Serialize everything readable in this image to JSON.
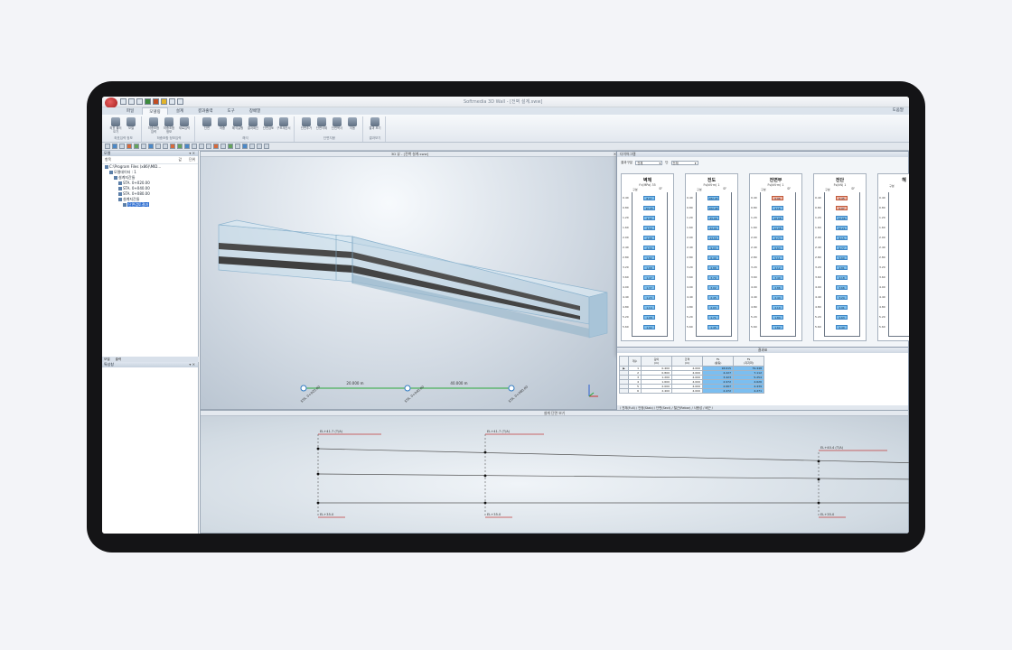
{
  "window": {
    "title": "Softmedia 3D Wall - [전벽 설계.sww]"
  },
  "ribbon": {
    "tabs": [
      {
        "label": "파일"
      },
      {
        "label": "모델링"
      },
      {
        "label": "설계"
      },
      {
        "label": "결과출력"
      },
      {
        "label": "도구"
      },
      {
        "label": "창배열"
      }
    ],
    "help_label": "도움말",
    "groups": [
      {
        "label": "좌표입력 정보",
        "buttons": [
          "좌표 불러오기",
          "모델"
        ]
      },
      {
        "label": "하중조합 정보입력",
        "buttons": [
          "하중조합 입력",
          "하중조합 정보",
          "재료입력"
        ]
      },
      {
        "label": "해석",
        "buttons": [
          "단면",
          "하중",
          "해석실행",
          "결과확인",
          "단면검토",
          "구조계산서"
        ]
      },
      {
        "label": "단면지붕",
        "buttons": [
          "단면추가",
          "단면삭제",
          "단면복사",
          "이동"
        ]
      },
      {
        "label": "결과보기",
        "buttons": [
          "결과 보기"
        ]
      }
    ]
  },
  "tree": {
    "panel_title": "모델",
    "columns": {
      "name": "항목",
      "value": "값",
      "unit": "단위"
    },
    "items": [
      {
        "label": "C:\\Program Files (x86)\\MID...",
        "indent": 0
      },
      {
        "label": "모델데이터 : 1",
        "indent": 1
      },
      {
        "label": "설계지간들",
        "indent": 2
      },
      {
        "label": "STA. 0+020.00",
        "indent": 3
      },
      {
        "label": "STA. 0+040.00",
        "indent": 3
      },
      {
        "label": "STA. 0+080.00",
        "indent": 3
      },
      {
        "label": "설계지간들",
        "indent": 3
      },
      {
        "label": "단면검토결과",
        "indent": 4,
        "selected": true
      }
    ],
    "bottom_tabs": [
      "모델",
      "출력"
    ],
    "lower_panel_title": "특성창"
  },
  "viewport": {
    "title": "3D 뷰 - [전벽 설계.sww]",
    "dims": [
      "20.000 m",
      "40.000 m"
    ],
    "stations": [
      "STA. 0+020.00",
      "STA. 0+040.00",
      "STA. 0+080.00"
    ]
  },
  "diagram": {
    "title": "다이어그램",
    "filter": {
      "label1": "결과구분",
      "value1": "전체",
      "label2": "단",
      "value2": "전체"
    },
    "columns": [
      {
        "title": "벽체",
        "sub": "f'c(MPa) 35",
        "h1": "구분",
        "h2": "SF",
        "rows": [
          {
            "l": "0.40",
            "v": "8.07",
            "red": false
          },
          {
            "l": "0.80",
            "v": "10.05",
            "red": false
          },
          {
            "l": "1.20",
            "v": "4.42",
            "red": false
          },
          {
            "l": "1.60",
            "v": "3.54",
            "red": false
          },
          {
            "l": "2.00",
            "v": "2.98",
            "red": false
          },
          {
            "l": "2.40",
            "v": "2.34",
            "red": false
          },
          {
            "l": "2.80",
            "v": "1.82",
            "red": false
          },
          {
            "l": "3.20",
            "v": "1.68",
            "red": false
          },
          {
            "l": "3.60",
            "v": "1.47",
            "red": false
          },
          {
            "l": "4.00",
            "v": "1.37",
            "red": false
          },
          {
            "l": "4.40",
            "v": "1.23",
            "red": false
          },
          {
            "l": "4.80",
            "v": "1.14",
            "red": false
          },
          {
            "l": "5.20",
            "v": "1.08",
            "red": false
          },
          {
            "l": "5.60",
            "v": "1.02",
            "red": false
          }
        ]
      },
      {
        "title": "전도",
        "sub": "Fs(kN·m) 1",
        "h1": "구분",
        "h2": "SF",
        "rows": [
          {
            "l": "0.40",
            "v": "182.45",
            "red": false
          },
          {
            "l": "0.80",
            "v": "102.48",
            "red": false
          },
          {
            "l": "1.20",
            "v": "45.06",
            "red": false
          },
          {
            "l": "1.60",
            "v": "22.91",
            "red": false
          },
          {
            "l": "2.00",
            "v": "13.55",
            "red": false
          },
          {
            "l": "2.40",
            "v": "9.03",
            "red": false
          },
          {
            "l": "2.80",
            "v": "6.49",
            "red": false
          },
          {
            "l": "3.20",
            "v": "4.88",
            "red": false
          },
          {
            "l": "3.60",
            "v": "3.79",
            "red": false
          },
          {
            "l": "4.00",
            "v": "3.02",
            "red": false
          },
          {
            "l": "4.40",
            "v": "2.45",
            "red": false
          },
          {
            "l": "4.80",
            "v": "2.03",
            "red": false
          },
          {
            "l": "5.20",
            "v": "1.71",
            "red": false
          },
          {
            "l": "5.60",
            "v": "1.45",
            "red": false
          }
        ]
      },
      {
        "title": "전면부",
        "sub": "Fs(kN·m) 1",
        "h1": "구분",
        "h2": "SF",
        "rows": [
          {
            "l": "0.40",
            "v": "0.96",
            "red": true
          },
          {
            "l": "0.80",
            "v": "4.16",
            "red": false
          },
          {
            "l": "1.20",
            "v": "18.08",
            "red": false
          },
          {
            "l": "1.60",
            "v": "12.08",
            "red": false
          },
          {
            "l": "2.00",
            "v": "8.73",
            "red": false
          },
          {
            "l": "2.40",
            "v": "6.63",
            "red": false
          },
          {
            "l": "2.80",
            "v": "5.11",
            "red": false
          },
          {
            "l": "3.20",
            "v": "4.12",
            "red": false
          },
          {
            "l": "3.60",
            "v": "3.40",
            "red": false
          },
          {
            "l": "4.00",
            "v": "2.86",
            "red": false
          },
          {
            "l": "4.40",
            "v": "2.44",
            "red": false
          },
          {
            "l": "4.80",
            "v": "2.10",
            "red": false
          },
          {
            "l": "5.20",
            "v": "1.84",
            "red": false
          },
          {
            "l": "5.60",
            "v": "1.62",
            "red": false
          }
        ]
      },
      {
        "title": "전단",
        "sub": "Fs(kN) 1",
        "h1": "구분",
        "h2": "SF",
        "rows": [
          {
            "l": "0.40",
            "v": "0.45",
            "red": true
          },
          {
            "l": "0.80",
            "v": "0.97",
            "red": true
          },
          {
            "l": "1.20",
            "v": "12.06",
            "red": false
          },
          {
            "l": "1.60",
            "v": "10.21",
            "red": false
          },
          {
            "l": "2.00",
            "v": "8.15",
            "red": false
          },
          {
            "l": "2.40",
            "v": "6.77",
            "red": false
          },
          {
            "l": "2.80",
            "v": "5.60",
            "red": false
          },
          {
            "l": "3.20",
            "v": "4.81",
            "red": false
          },
          {
            "l": "3.60",
            "v": "4.18",
            "red": false
          },
          {
            "l": "4.00",
            "v": "3.66",
            "red": false
          },
          {
            "l": "4.40",
            "v": "3.24",
            "red": false
          },
          {
            "l": "4.80",
            "v": "2.91",
            "red": false
          },
          {
            "l": "5.20",
            "v": "2.63",
            "red": false
          },
          {
            "l": "5.60",
            "v": "2.40",
            "red": false
          }
        ]
      },
      {
        "title": "해",
        "sub": "",
        "h1": "구분",
        "h2": "",
        "rows": [
          {
            "l": "0.40",
            "v": "",
            "red": false
          },
          {
            "l": "0.80",
            "v": "",
            "red": false
          },
          {
            "l": "1.20",
            "v": "",
            "red": false
          },
          {
            "l": "1.60",
            "v": "",
            "red": false
          },
          {
            "l": "2.00",
            "v": "",
            "red": false
          },
          {
            "l": "2.40",
            "v": "",
            "red": false
          },
          {
            "l": "2.80",
            "v": "",
            "red": false
          },
          {
            "l": "3.20",
            "v": "",
            "red": false
          },
          {
            "l": "3.60",
            "v": "",
            "red": false
          },
          {
            "l": "4.00",
            "v": "",
            "red": false
          },
          {
            "l": "4.40",
            "v": "",
            "red": false
          },
          {
            "l": "4.80",
            "v": "",
            "red": false
          },
          {
            "l": "5.20",
            "v": "",
            "red": false
          },
          {
            "l": "5.60",
            "v": "",
            "red": false
          }
        ]
      }
    ]
  },
  "table": {
    "title": "결과표",
    "headers": [
      "",
      "개수",
      "깊이\n(m)",
      "간격\n(m)",
      "FS\n(활동)",
      "FS\n(지지력)"
    ],
    "rows": [
      [
        "▶",
        "1",
        "0.400",
        "4.000",
        "18.615",
        "79.448"
      ],
      [
        "",
        "2",
        "0.800",
        "4.000",
        "4.227",
        "7.112"
      ],
      [
        "",
        "3",
        "1.200",
        "4.000",
        "3.423",
        "5.254"
      ],
      [
        "",
        "4",
        "1.600",
        "4.000",
        "2.972",
        "4.626"
      ],
      [
        "",
        "5",
        "2.000",
        "4.000",
        "2.667",
        "4.439"
      ],
      [
        "",
        "6",
        "2.400",
        "4.000",
        "2.472",
        "4.271"
      ]
    ],
    "sheet_tabs": "\\ 전체(Full) / 안정(Stab) / 단면(Sect) / 철근(Rebar) / 사용성 / 배근 /"
  },
  "bottom": {
    "title": "설계 단면 보기",
    "labels": [
      "EL+41.7 (T/A)",
      "EL+41.7 (T/A)",
      "EL+40.4 (T/A)",
      "EL+35.0",
      "EL+35.0",
      "EL+35.0"
    ]
  }
}
